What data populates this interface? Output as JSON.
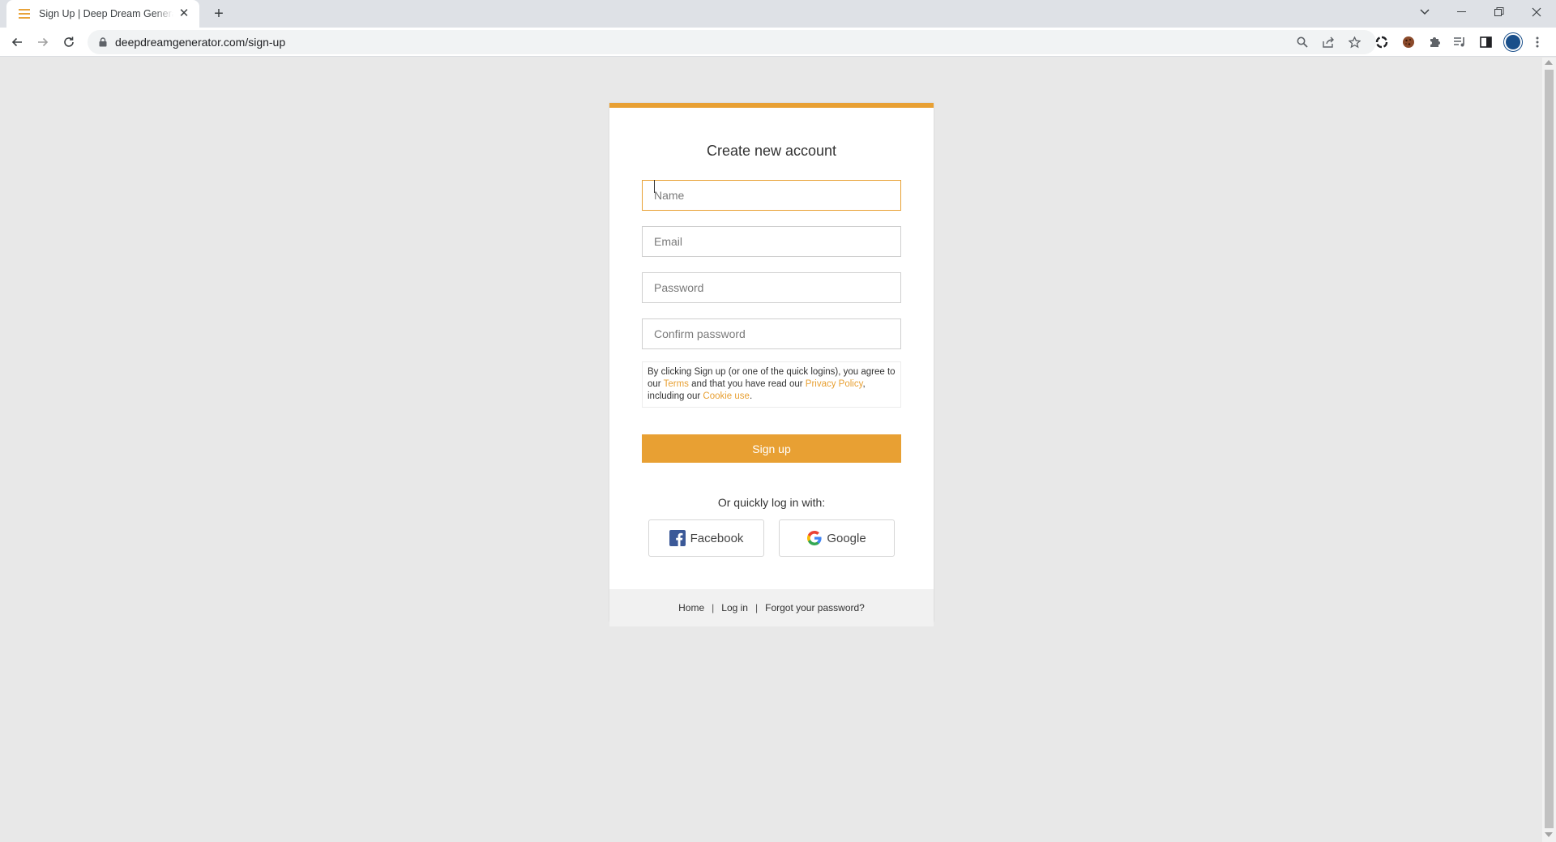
{
  "browser": {
    "tab_title": "Sign Up | Deep Dream Generator",
    "url": "deepdreamgenerator.com/sign-up",
    "brand_color": "#e8a033"
  },
  "form": {
    "title": "Create new account",
    "name_placeholder": "Name",
    "email_placeholder": "Email",
    "password_placeholder": "Password",
    "confirm_placeholder": "Confirm password",
    "terms_prefix": "By clicking Sign up (or one of the quick logins), you agree to our ",
    "terms_link": "Terms",
    "terms_middle": " and that you have read our ",
    "privacy_link": "Privacy Policy",
    "terms_middle2": ", including our ",
    "cookie_link": "Cookie use",
    "terms_end": ".",
    "signup_label": "Sign up",
    "quick_login_text": "Or quickly log in with:",
    "facebook_label": "Facebook",
    "google_label": "Google"
  },
  "footer": {
    "home": "Home",
    "login": "Log in",
    "forgot": "Forgot your password?",
    "separator": "|"
  }
}
